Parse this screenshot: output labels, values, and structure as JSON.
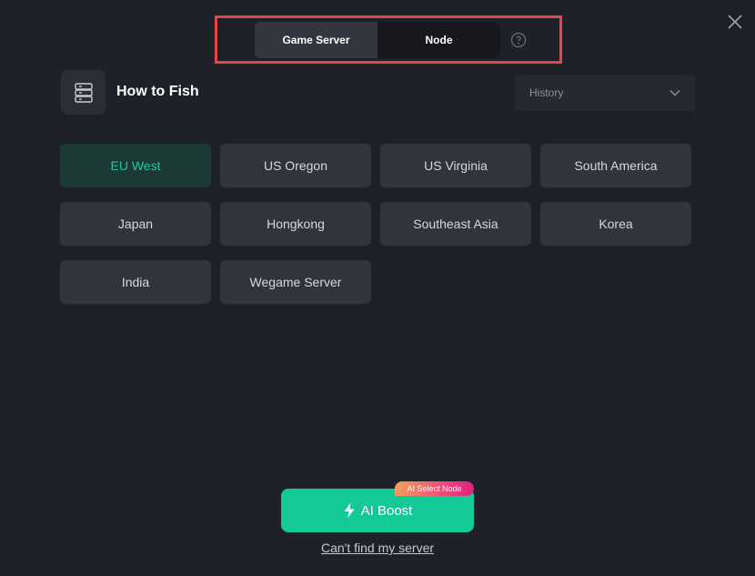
{
  "header": {
    "tabs": [
      {
        "label": "Game Server",
        "active": true
      },
      {
        "label": "Node",
        "active": false
      }
    ],
    "help_icon": "question-circle-icon",
    "close_icon": "close-x-icon"
  },
  "game": {
    "title": "How to Fish",
    "icon": "server-stack-icon"
  },
  "history": {
    "label": "History",
    "icon": "chevron-down-icon"
  },
  "servers": [
    {
      "label": "EU West",
      "selected": true
    },
    {
      "label": "US Oregon",
      "selected": false
    },
    {
      "label": "US Virginia",
      "selected": false
    },
    {
      "label": "South America",
      "selected": false
    },
    {
      "label": "Japan",
      "selected": false
    },
    {
      "label": "Hongkong",
      "selected": false
    },
    {
      "label": "Southeast Asia",
      "selected": false
    },
    {
      "label": "Korea",
      "selected": false
    },
    {
      "label": "India",
      "selected": false
    },
    {
      "label": "Wegame Server",
      "selected": false
    }
  ],
  "boost": {
    "label": "AI Boost",
    "badge": "AI Select Node",
    "icon": "lightning-bolt-icon"
  },
  "footer": {
    "link": "Can't find my server"
  },
  "colors": {
    "accent": "#14c998",
    "selected_bg": "#1b3a36",
    "selected_text": "#1ec99a",
    "highlight_border": "#e0484a"
  }
}
